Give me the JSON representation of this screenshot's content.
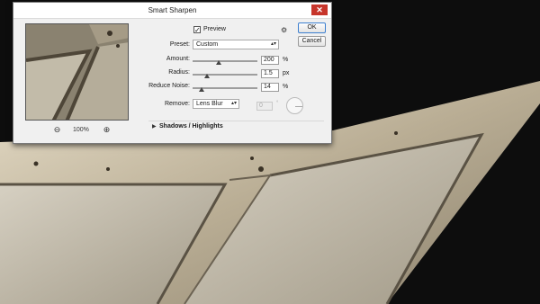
{
  "dialog": {
    "title": "Smart Sharpen",
    "close_label": "✕",
    "preview": {
      "checked": true,
      "check_mark": "✓",
      "label": "Preview",
      "zoom_level": "100%",
      "zoom_out_icon": "zoom-out-icon",
      "zoom_in_icon": "zoom-in-icon"
    },
    "settings_icon": "gear-icon",
    "buttons": {
      "ok": "OK",
      "cancel": "Cancel"
    },
    "preset": {
      "label": "Preset:",
      "value": "Custom"
    },
    "amount": {
      "label": "Amount:",
      "value": "200",
      "unit": "%",
      "level": 0.4
    },
    "radius": {
      "label": "Radius:",
      "value": "1.5",
      "unit": "px",
      "level": 0.22
    },
    "reduce_noise": {
      "label": "Reduce Noise:",
      "value": "14",
      "unit": "%",
      "level": 0.14
    },
    "remove": {
      "label": "Remove:",
      "value": "Lens Blur",
      "angle": "0",
      "angle_unit": "°"
    },
    "shadows_highlights": {
      "label": "Shadows / Highlights",
      "expanded": false,
      "twisty": "▶"
    }
  },
  "colors": {
    "dialog_bg": "#f0f0f0",
    "close_button": "#c7352b",
    "ok_border": "#3c7fd0",
    "photo_background": "#0d0d0d",
    "metal": "#c9bfa8"
  }
}
